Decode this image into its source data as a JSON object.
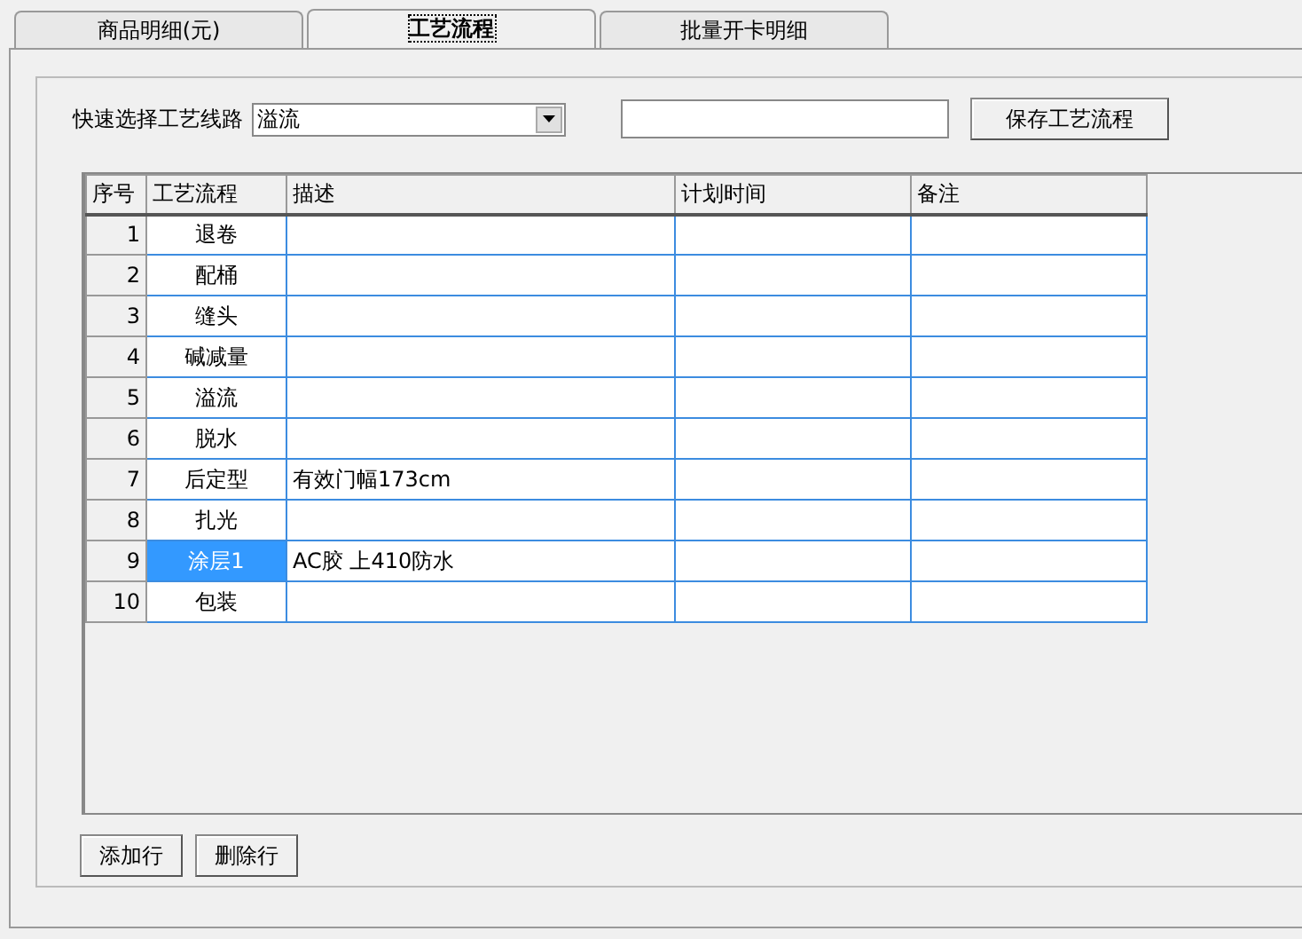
{
  "tabs": [
    {
      "label": "商品明细(元)",
      "selected": false
    },
    {
      "label": "工艺流程",
      "selected": true
    },
    {
      "label": "批量开卡明细",
      "selected": false
    }
  ],
  "quick_select": {
    "label": "快速选择工艺线路",
    "value": "溢流"
  },
  "save_button": "保存工艺流程",
  "table": {
    "columns": [
      "序号",
      "工艺流程",
      "描述",
      "计划时间",
      "备注"
    ],
    "rows": [
      {
        "no": "1",
        "process": "退卷",
        "selected": false
      },
      {
        "no": "2",
        "process": "配桶",
        "selected": false
      },
      {
        "no": "3",
        "process": "缝头",
        "selected": false
      },
      {
        "no": "4",
        "process": "碱减量",
        "selected": false
      },
      {
        "no": "5",
        "process": "溢流",
        "selected": false
      },
      {
        "no": "6",
        "process": "脱水",
        "selected": false
      },
      {
        "no": "7",
        "process": "后定型",
        "description": "有效门幅173cm",
        "selected": false
      },
      {
        "no": "8",
        "process": "扎光",
        "selected": false
      },
      {
        "no": "9",
        "process": "涂层1",
        "description": "AC胶 上410防水",
        "selected": true
      },
      {
        "no": "10",
        "process": "包装",
        "selected": false
      }
    ]
  },
  "buttons": [
    "添加行",
    "删除行"
  ]
}
